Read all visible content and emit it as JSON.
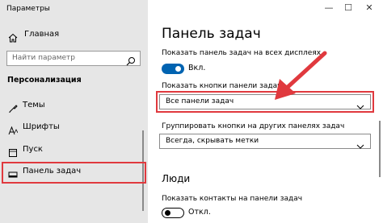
{
  "window": {
    "title": "Параметры",
    "minimize_glyph": "—",
    "maximize_glyph": "☐",
    "close_glyph": "✕"
  },
  "sidebar": {
    "home_label": "Главная",
    "search_placeholder": "Найти параметр",
    "section_title": "Персонализация",
    "items": [
      {
        "label": "Темы",
        "icon": "brush-icon"
      },
      {
        "label": "Шрифты",
        "icon": "font-icon"
      },
      {
        "label": "Пуск",
        "icon": "start-icon"
      },
      {
        "label": "Панель задач",
        "icon": "taskbar-icon",
        "selected": true
      }
    ]
  },
  "main": {
    "title": "Панель задач",
    "show_all_displays": {
      "label": "Показать панель задач на всех дисплеях",
      "state": "Вкл.",
      "on": true
    },
    "show_buttons": {
      "label": "Показать кнопки панели задач:",
      "value": "Все панели задач"
    },
    "group_buttons": {
      "label": "Группировать кнопки на других панелях задач",
      "value": "Всегда, скрывать метки"
    },
    "people": {
      "heading": "Люди",
      "show_contacts_label": "Показать контакты на панели задач",
      "state": "Откл.",
      "on": false
    }
  },
  "colors": {
    "accent": "#0063b1",
    "highlight": "#e0393e",
    "sidebar_bg": "#e6e6e6"
  }
}
